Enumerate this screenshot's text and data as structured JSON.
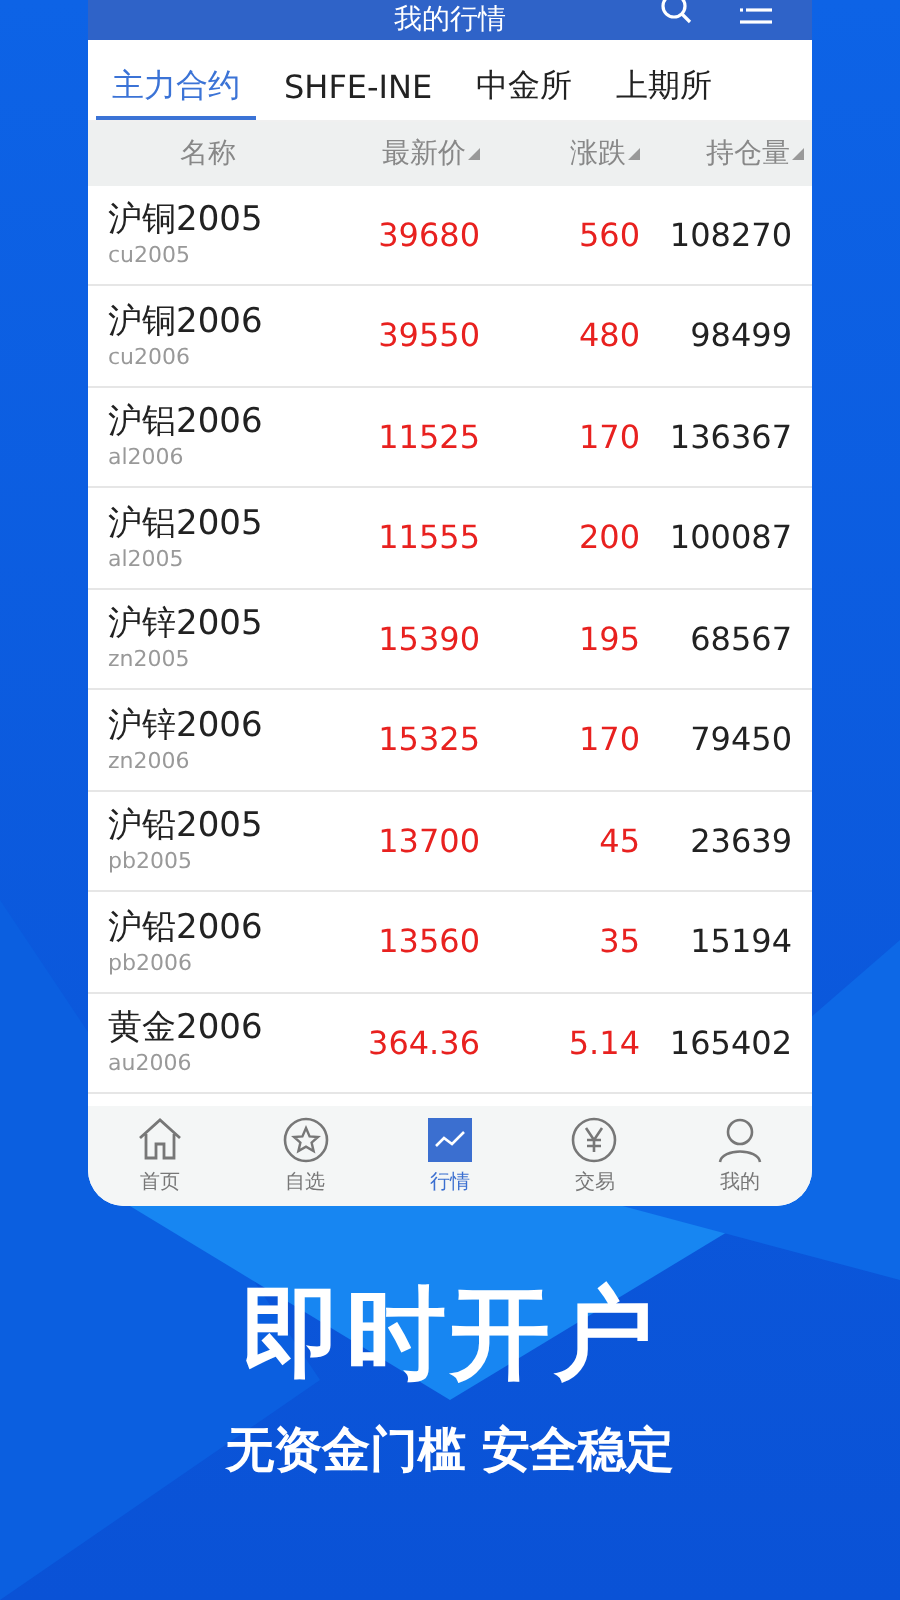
{
  "header": {
    "title": "我的行情"
  },
  "tabs": [
    {
      "label": "主力合约",
      "selected": true
    },
    {
      "label": "SHFE-INE",
      "selected": false
    },
    {
      "label": "中金所",
      "selected": false
    },
    {
      "label": "上期所",
      "selected": false
    }
  ],
  "table": {
    "columns": [
      "名称",
      "最新价",
      "涨跌",
      "持仓量"
    ],
    "rows": [
      {
        "name": "沪铜2005",
        "code": "cu2005",
        "price": "39680",
        "change": "560",
        "open_interest": "108270"
      },
      {
        "name": "沪铜2006",
        "code": "cu2006",
        "price": "39550",
        "change": "480",
        "open_interest": "98499"
      },
      {
        "name": "沪铝2006",
        "code": "al2006",
        "price": "11525",
        "change": "170",
        "open_interest": "136367"
      },
      {
        "name": "沪铝2005",
        "code": "al2005",
        "price": "11555",
        "change": "200",
        "open_interest": "100087"
      },
      {
        "name": "沪锌2005",
        "code": "zn2005",
        "price": "15390",
        "change": "195",
        "open_interest": "68567"
      },
      {
        "name": "沪锌2006",
        "code": "zn2006",
        "price": "15325",
        "change": "170",
        "open_interest": "79450"
      },
      {
        "name": "沪铅2005",
        "code": "pb2005",
        "price": "13700",
        "change": "45",
        "open_interest": "23639"
      },
      {
        "name": "沪铅2006",
        "code": "pb2006",
        "price": "13560",
        "change": "35",
        "open_interest": "15194"
      },
      {
        "name": "黄金2006",
        "code": "au2006",
        "price": "364.36",
        "change": "5.14",
        "open_interest": "165402"
      }
    ]
  },
  "bottom_nav": [
    {
      "label": "首页",
      "kind": "home",
      "selected": false
    },
    {
      "label": "自选",
      "kind": "star",
      "selected": false
    },
    {
      "label": "行情",
      "kind": "chart",
      "selected": true
    },
    {
      "label": "交易",
      "kind": "yen",
      "selected": false
    },
    {
      "label": "我的",
      "kind": "person",
      "selected": false
    }
  ],
  "promo": {
    "headline": "即时开户",
    "subline": "无资金门槛 安全稳定"
  }
}
